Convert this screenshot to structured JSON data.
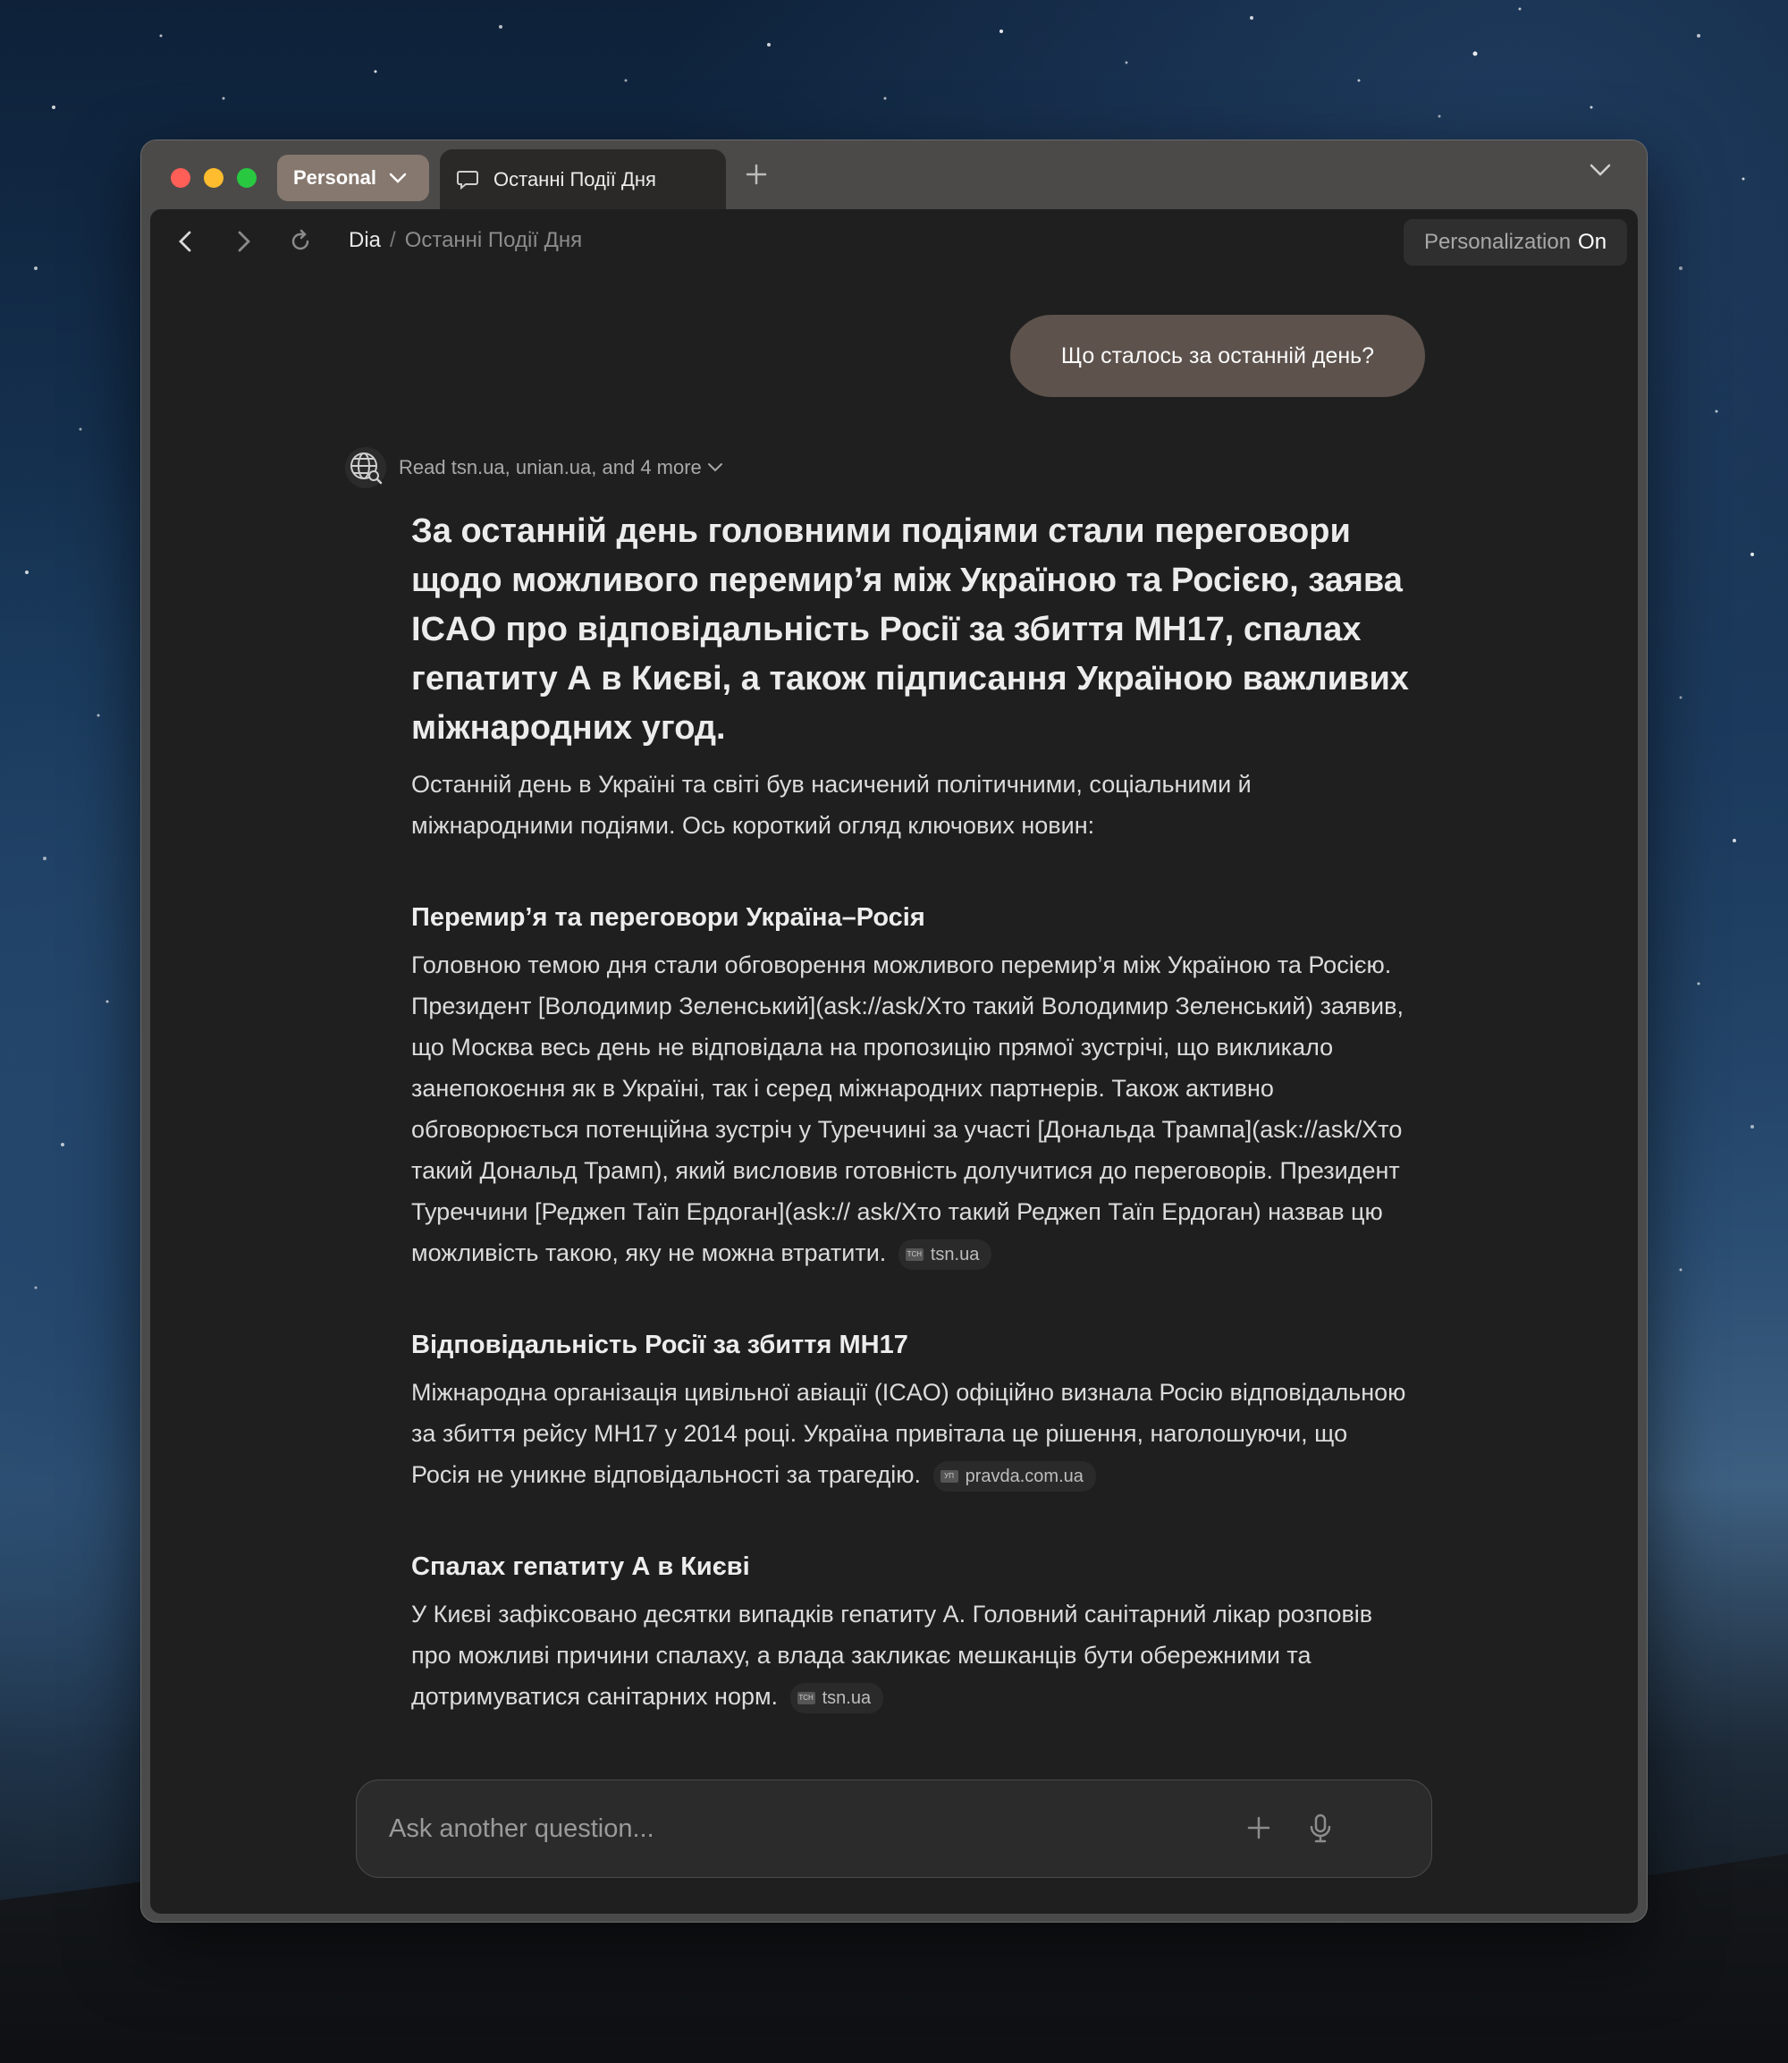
{
  "browser": {
    "profile_label": "Personal",
    "tab_title": "Останні Події Дня",
    "breadcrumb_root": "Dia",
    "breadcrumb_separator": "/",
    "breadcrumb_current": "Останні Події Дня",
    "personalization_label": "Personalization",
    "personalization_state": "On"
  },
  "chat": {
    "user_message": "Що сталось за останній день?",
    "sources_text": "Read tsn.ua, unian.ua, and 4 more",
    "headline": "За останній день головними подіями стали переговори щодо можливого перемир’я між Україною та Росією, заява ICAO про відповідальність Росії за збиття MH17, спалах гепатиту А в Києві, а також підписання Україною важливих міжнародних угод.",
    "intro": "Останній день в Україні та світі був насичений політичними, соціальними й міжнародними подіями. Ось короткий огляд ключових новин:",
    "sections": [
      {
        "title": "Перемир’я та переговори Україна–Росія",
        "body": "Головною темою дня стали обговорення можливого перемир’я між Україною та Росією. Президент [Володимир Зеленський](ask://ask/Хто такий Володимир Зеленський) заявив, що Москва весь день не відповідала на пропозицію прямої зустрічі, що викликало занепокоєння як в Україні, так і серед міжнародних партнерів. Також активно обговорюється потенційна зустріч у Туреччині за участі [Дональда Трампа](ask://ask/Хто такий Дональд Трамп), який висловив готовність долучитися до переговорів. Президент Туреччини [Реджеп Таїп Ердоган](ask:// ask/Хто такий Реджеп Таїп Ердоган) назвав цю можливість такою, яку не можна втратити.",
        "source": "tsn.ua",
        "source_icon_text": "ТСН"
      },
      {
        "title": "Відповідальність Росії за збиття MH17",
        "body": "Міжнародна організація цивільної авіації (ICAO) офіційно визнала Росію відповідальною за збиття рейсу MH17 у 2014 році. Україна привітала це рішення, наголошуючи, що Росія не уникне відповідальності за трагедію.",
        "source": "pravda.com.ua",
        "source_icon_text": "УП"
      },
      {
        "title": "Спалах гепатиту А в Києві",
        "body": "У Києві зафіксовано десятки випадків гепатиту А. Головний санітарний лікар розповів про можливі причини спалаху, а влада закликає мешканців бути обережними та дотримуватися санітарних норм.",
        "source": "tsn.ua",
        "source_icon_text": "ТСН"
      }
    ],
    "ask_placeholder": "Ask another question..."
  },
  "colors": {
    "user_bubble": "#5d524c",
    "content_bg": "#1f1f1f",
    "profile_pill": "#86786e"
  },
  "icons": [
    "chat-bubble-icon",
    "plus-icon",
    "chevron-down-icon",
    "back-arrow-icon",
    "forward-arrow-icon",
    "reload-icon",
    "globe-search-icon",
    "microphone-icon"
  ]
}
